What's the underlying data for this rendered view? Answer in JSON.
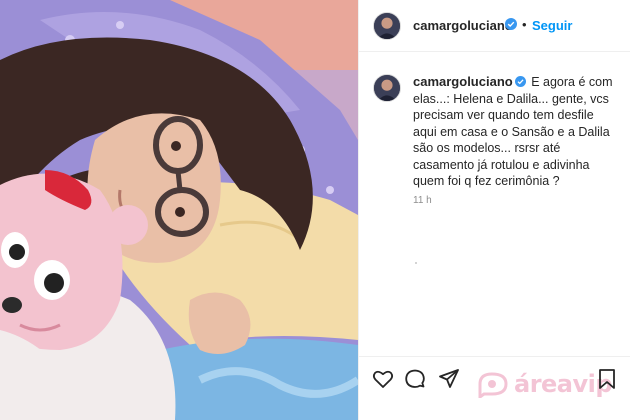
{
  "post": {
    "username": "camargoluciano",
    "follow_label": "Seguir",
    "separator": "•",
    "caption": "E agora é com elas...: Helena e Dalila... gente, vcs precisam ver quando tem desfile aqui em casa e o Sansão e a Dalila são os modelos... rsrsr até casamento já rotulou e adivinha quem foi q fez cerimônia ?",
    "time": "11 h"
  },
  "icons": {
    "verified": "verified-badge-icon",
    "like": "heart-icon",
    "comment": "comment-bubble-icon",
    "share": "paper-plane-icon",
    "save": "bookmark-icon"
  },
  "watermark": {
    "text": "áreavip"
  },
  "colors": {
    "follow": "#0095f6",
    "verified": "#3897f0",
    "watermark": "#f3c0d2",
    "border": "#efefef",
    "muted": "#8e8e8e"
  }
}
